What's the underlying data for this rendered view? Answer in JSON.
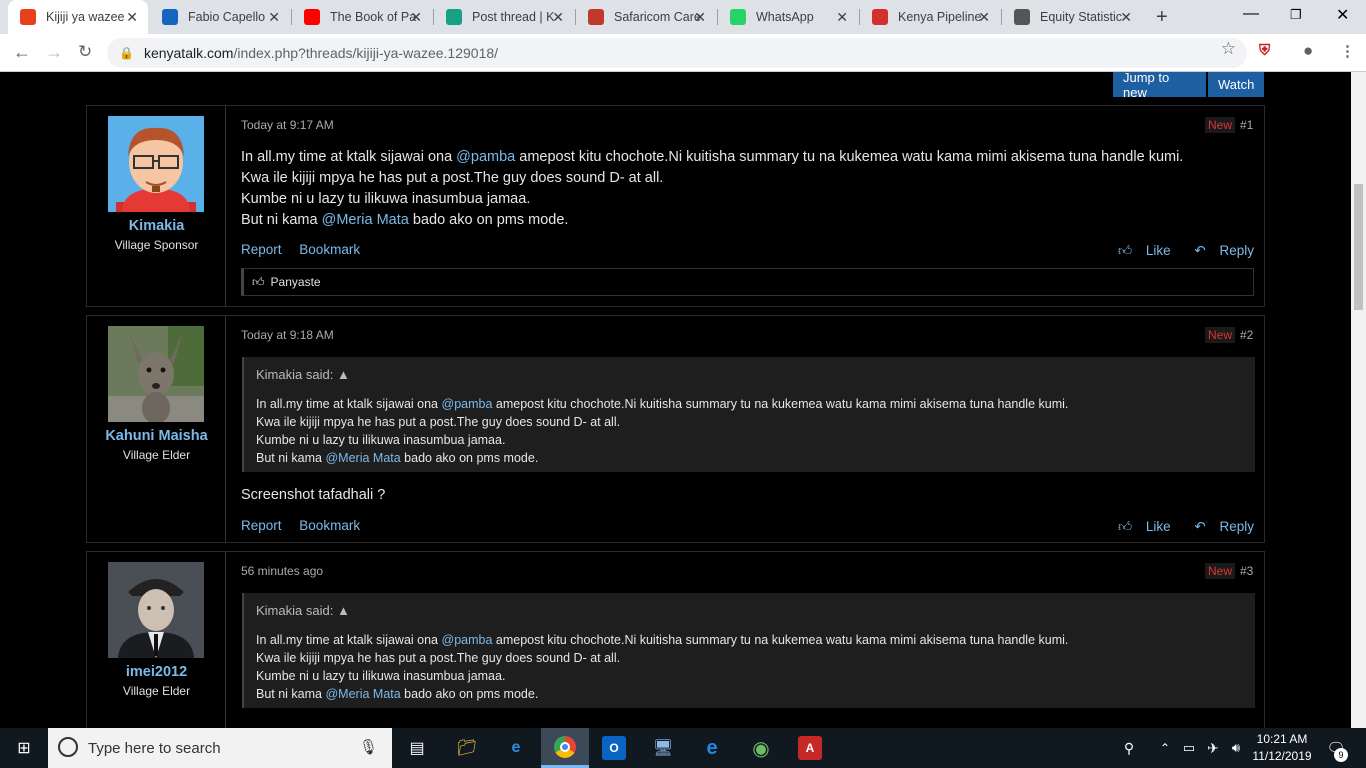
{
  "browser": {
    "tabs": [
      {
        "label": "Kijiji ya wazee",
        "icon": "kenyatalk-icon",
        "color": "#e8401c",
        "active": true
      },
      {
        "label": "Fabio Capello",
        "icon": "m-icon",
        "color": "#1565c0"
      },
      {
        "label": "The Book of Pa",
        "icon": "youtube-icon",
        "color": "#ff0000"
      },
      {
        "label": "Post thread | K",
        "icon": "kenyatalk-k-icon",
        "color": "#16a085"
      },
      {
        "label": "Safaricom Care",
        "icon": "safaricom-icon",
        "color": "#c0392b"
      },
      {
        "label": "WhatsApp",
        "icon": "whatsapp-icon",
        "color": "#25d366"
      },
      {
        "label": "Kenya Pipeline",
        "icon": "kenya-pipeline-icon",
        "color": "#d32f2f"
      },
      {
        "label": "Equity Statistic",
        "icon": "card-icon",
        "color": "#555555"
      }
    ],
    "url_host": "kenyatalk.com",
    "url_path": "/index.php?threads/kijiji-ya-wazee.129018/"
  },
  "thread_controls": {
    "jump_label": "Jump to new",
    "watch_label": "Watch"
  },
  "posts": [
    {
      "username": "Kimakia",
      "user_title": "Village Sponsor",
      "time": "Today at 9:17 AM",
      "new_label": "New",
      "number": "#1",
      "lines": [
        {
          "pre": "In all.my time at ktalk sijawai ona ",
          "mention": "@pamba",
          "post": " amepost kitu chochote.Ni kuitisha summary tu na kukemea watu kama mimi akisema tuna handle kumi."
        },
        {
          "pre": "Kwa ile kijiji mpya he has put a post.The guy does sound D- at all.",
          "mention": "",
          "post": ""
        },
        {
          "pre": "Kumbe ni u lazy tu ilikuwa inasumbua jamaa.",
          "mention": "",
          "post": ""
        },
        {
          "pre": "But ni kama ",
          "mention": "@Meria Mata",
          "post": " bado ako on pms mode."
        }
      ],
      "report": "Report",
      "bookmark": "Bookmark",
      "like": "Like",
      "reply": "Reply",
      "liked_by": "Panyaste"
    },
    {
      "username": "Kahuni Maisha",
      "user_title": "Village Elder",
      "time": "Today at 9:18 AM",
      "new_label": "New",
      "number": "#2",
      "quote_author": "Kimakia said:",
      "quote_lines": [
        {
          "pre": "In all.my time at ktalk sijawai ona ",
          "mention": "@pamba",
          "post": " amepost kitu chochote.Ni kuitisha summary tu na kukemea watu kama mimi akisema tuna handle kumi."
        },
        {
          "pre": "Kwa ile kijiji mpya he has put a post.The guy does sound D- at all.",
          "mention": "",
          "post": ""
        },
        {
          "pre": "Kumbe ni u lazy tu ilikuwa inasumbua jamaa.",
          "mention": "",
          "post": ""
        },
        {
          "pre": "But ni kama ",
          "mention": "@Meria Mata",
          "post": " bado ako on pms mode."
        }
      ],
      "body": "Screenshot tafadhali ?",
      "report": "Report",
      "bookmark": "Bookmark",
      "like": "Like",
      "reply": "Reply"
    },
    {
      "username": "imei2012",
      "user_title": "Village Elder",
      "time": "56 minutes ago",
      "new_label": "New",
      "number": "#3",
      "quote_author": "Kimakia said:",
      "quote_lines": [
        {
          "pre": "In all.my time at ktalk sijawai ona ",
          "mention": "@pamba",
          "post": " amepost kitu chochote.Ni kuitisha summary tu na kukemea watu kama mimi akisema tuna handle kumi."
        },
        {
          "pre": "Kwa ile kijiji mpya he has put a post.The guy does sound D- at all.",
          "mention": "",
          "post": ""
        },
        {
          "pre": "Kumbe ni u lazy tu ilikuwa inasumbua jamaa.",
          "mention": "",
          "post": ""
        },
        {
          "pre": "But ni kama ",
          "mention": "@Meria Mata",
          "post": " bado ako on pms mode."
        }
      ]
    }
  ],
  "taskbar": {
    "search_placeholder": "Type here to search",
    "time": "10:21 AM",
    "date": "11/12/2019",
    "notification_count": "9"
  }
}
